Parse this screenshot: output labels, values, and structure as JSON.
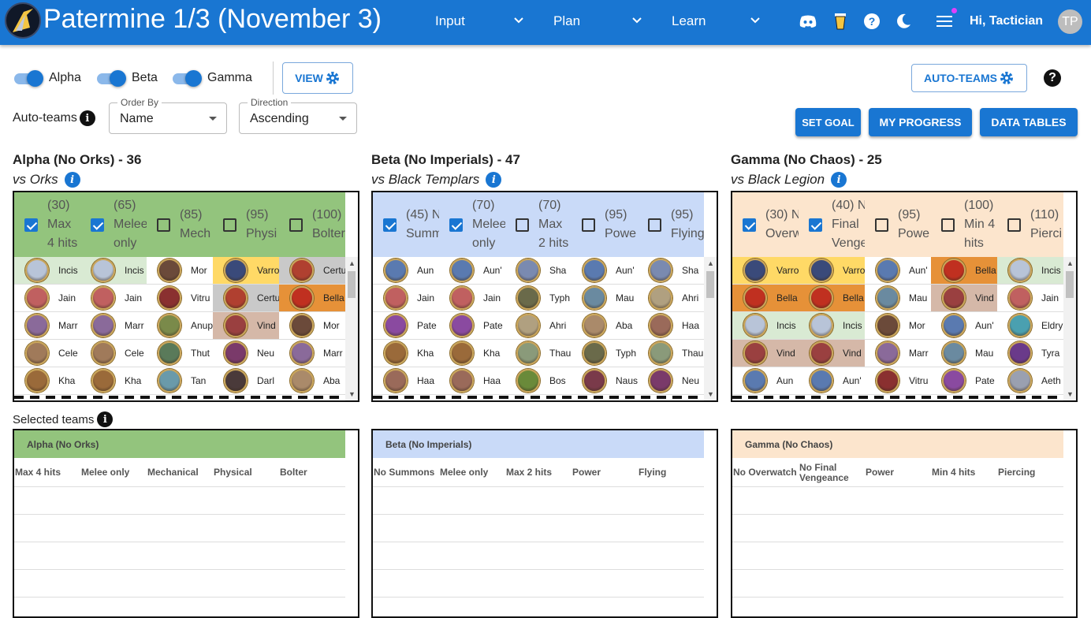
{
  "app": {
    "title": "Patermine 1/3 (November 3)",
    "greeting": "Hi, Tactician",
    "avatar_initials": "TP"
  },
  "nav": [
    {
      "label": "Input"
    },
    {
      "label": "Plan"
    },
    {
      "label": "Learn"
    }
  ],
  "top_icons": [
    "discord-icon",
    "coffee-cup-icon",
    "help-circle-icon",
    "dark-mode-moon-icon",
    "hamburger-menu-icon"
  ],
  "toggles": [
    {
      "label": "Alpha",
      "on": true
    },
    {
      "label": "Beta",
      "on": true
    },
    {
      "label": "Gamma",
      "on": true
    }
  ],
  "buttons": {
    "view": "VIEW",
    "auto_teams": "AUTO-TEAMS",
    "set_goal": "SET GOAL",
    "my_progress": "MY PROGRESS",
    "data_tables": "DATA TABLES",
    "help": "?"
  },
  "auto_teams_label": "Auto-teams",
  "order_by": {
    "label": "Order By",
    "value": "Name"
  },
  "direction": {
    "label": "Direction",
    "value": "Ascending"
  },
  "selected_teams_label": "Selected teams",
  "colors": {
    "primary": "#1976d2",
    "alpha": "#93c47d",
    "beta": "#c9daf8",
    "gamma": "#fce5cd",
    "alpha_light": "#d9ead3",
    "yellow": "#ffd966",
    "orange": "#e69138",
    "taupe": "#d5b8a8",
    "grey": "#c9c9c9"
  },
  "guilds": [
    {
      "title": "Alpha (No Orks) - 36",
      "subtitle": "vs Orks",
      "header_color": "#93c47d",
      "columns": [
        {
          "checked": true,
          "lines": [
            "(30)",
            "Max",
            "4 hits"
          ]
        },
        {
          "checked": true,
          "lines": [
            "(65)",
            "Melee",
            "only"
          ]
        },
        {
          "checked": false,
          "lines": [
            "(85)",
            "Mech"
          ]
        },
        {
          "checked": false,
          "lines": [
            "(95)",
            "Physi"
          ]
        },
        {
          "checked": false,
          "lines": [
            "(100)",
            "Bolter"
          ]
        }
      ],
      "rows": [
        [
          {
            "name": "Incis",
            "bg": "#d9ead3",
            "c": "#b8c4d8"
          },
          {
            "name": "Incis",
            "bg": "#d9ead3",
            "c": "#b8c4d8"
          },
          {
            "name": "Mor",
            "bg": "",
            "c": "#6b4a3a"
          },
          {
            "name": "Varro",
            "bg": "#ffd966",
            "c": "#3a4a7a"
          },
          {
            "name": "Certu",
            "bg": "#c9c9c9",
            "c": "#b04030"
          }
        ],
        [
          {
            "name": "Jain",
            "bg": "",
            "c": "#c06060"
          },
          {
            "name": "Jain",
            "bg": "",
            "c": "#c06060"
          },
          {
            "name": "Vitru",
            "bg": "",
            "c": "#8a3030"
          },
          {
            "name": "Certu",
            "bg": "#c9c9c9",
            "c": "#b04030"
          },
          {
            "name": "Bella",
            "bg": "#e69138",
            "c": "#c03020"
          }
        ],
        [
          {
            "name": "Marr",
            "bg": "",
            "c": "#8a6a9a"
          },
          {
            "name": "Marr",
            "bg": "",
            "c": "#8a6a9a"
          },
          {
            "name": "Anup",
            "bg": "",
            "c": "#7a8a4a"
          },
          {
            "name": "Vind",
            "bg": "#d5b8a8",
            "c": "#9a4040"
          },
          {
            "name": "Mor",
            "bg": "",
            "c": "#6b4a3a"
          }
        ],
        [
          {
            "name": "Cele",
            "bg": "",
            "c": "#a07a5a"
          },
          {
            "name": "Cele",
            "bg": "",
            "c": "#a07a5a"
          },
          {
            "name": "Thut",
            "bg": "",
            "c": "#5a7a5a"
          },
          {
            "name": "Neu",
            "bg": "",
            "c": "#7a3a6a"
          },
          {
            "name": "Marr",
            "bg": "",
            "c": "#8a6a9a"
          }
        ],
        [
          {
            "name": "Kha",
            "bg": "",
            "c": "#9a6a3a"
          },
          {
            "name": "Kha",
            "bg": "",
            "c": "#9a6a3a"
          },
          {
            "name": "Tan",
            "bg": "",
            "c": "#6a9aaa"
          },
          {
            "name": "Darl",
            "bg": "",
            "c": "#4a3a3a"
          },
          {
            "name": "Aba",
            "bg": "",
            "c": "#aa8a6a"
          }
        ]
      ],
      "team_header": "Alpha (No Orks)",
      "team_columns": [
        [
          "Max 4 hits"
        ],
        [
          "Melee only"
        ],
        [
          "Mechanical"
        ],
        [
          "Physical"
        ],
        [
          "Bolter"
        ]
      ]
    },
    {
      "title": "Beta (No Imperials) - 47",
      "subtitle": "vs Black Templars",
      "header_color": "#c9daf8",
      "columns": [
        {
          "checked": true,
          "lines": [
            "(45) N",
            "Summ"
          ]
        },
        {
          "checked": true,
          "lines": [
            "(70)",
            "Melee",
            "only"
          ]
        },
        {
          "checked": false,
          "lines": [
            "(70)",
            "Max",
            "2 hits"
          ]
        },
        {
          "checked": false,
          "lines": [
            "(95)",
            "Powe"
          ]
        },
        {
          "checked": false,
          "lines": [
            "(95)",
            "Flying"
          ]
        }
      ],
      "rows": [
        [
          {
            "name": "Aun",
            "bg": "",
            "c": "#5a7ab0"
          },
          {
            "name": "Aun'",
            "bg": "",
            "c": "#5a7ab0"
          },
          {
            "name": "Sha",
            "bg": "",
            "c": "#7a8ab0"
          },
          {
            "name": "Aun'",
            "bg": "",
            "c": "#5a7ab0"
          },
          {
            "name": "Sha",
            "bg": "",
            "c": "#7a8ab0"
          }
        ],
        [
          {
            "name": "Jain",
            "bg": "",
            "c": "#c06060"
          },
          {
            "name": "Jain",
            "bg": "",
            "c": "#c06060"
          },
          {
            "name": "Typh",
            "bg": "",
            "c": "#6a6a4a"
          },
          {
            "name": "Mau",
            "bg": "",
            "c": "#6a8aa0"
          },
          {
            "name": "Ahri",
            "bg": "",
            "c": "#b0a080"
          }
        ],
        [
          {
            "name": "Pate",
            "bg": "",
            "c": "#8a4aa0"
          },
          {
            "name": "Pate",
            "bg": "",
            "c": "#8a4aa0"
          },
          {
            "name": "Ahri",
            "bg": "",
            "c": "#b0a080"
          },
          {
            "name": "Aba",
            "bg": "",
            "c": "#aa8a6a"
          },
          {
            "name": "Haa",
            "bg": "",
            "c": "#9a6a5a"
          }
        ],
        [
          {
            "name": "Kha",
            "bg": "",
            "c": "#9a6a3a"
          },
          {
            "name": "Kha",
            "bg": "",
            "c": "#9a6a3a"
          },
          {
            "name": "Thau",
            "bg": "",
            "c": "#8a9a7a"
          },
          {
            "name": "Typh",
            "bg": "",
            "c": "#6a6a4a"
          },
          {
            "name": "Thau",
            "bg": "",
            "c": "#8a9a7a"
          }
        ],
        [
          {
            "name": "Haa",
            "bg": "",
            "c": "#9a6a5a"
          },
          {
            "name": "Haa",
            "bg": "",
            "c": "#9a6a5a"
          },
          {
            "name": "Bos",
            "bg": "",
            "c": "#6a8a3a"
          },
          {
            "name": "Naus",
            "bg": "",
            "c": "#7a3a4a"
          },
          {
            "name": "Neu",
            "bg": "",
            "c": "#7a3a6a"
          }
        ]
      ],
      "team_header": "Beta (No Imperials)",
      "team_columns": [
        [
          "No Summons"
        ],
        [
          "Melee only"
        ],
        [
          "Max 2 hits"
        ],
        [
          "Power"
        ],
        [
          "Flying"
        ]
      ]
    },
    {
      "title": "Gamma (No Chaos) - 25",
      "subtitle": "vs Black Legion",
      "header_color": "#fce5cd",
      "columns": [
        {
          "checked": true,
          "lines": [
            "(30) N",
            "Overw"
          ]
        },
        {
          "checked": true,
          "lines": [
            "(40) N",
            "Final",
            "Venge"
          ]
        },
        {
          "checked": false,
          "lines": [
            "(95)",
            "Powe"
          ]
        },
        {
          "checked": false,
          "lines": [
            "(100)",
            "Min 4",
            "hits"
          ]
        },
        {
          "checked": false,
          "lines": [
            "(110)",
            "Pierci"
          ]
        }
      ],
      "rows": [
        [
          {
            "name": "Varro",
            "bg": "#ffd966",
            "c": "#3a4a7a"
          },
          {
            "name": "Varro",
            "bg": "#ffd966",
            "c": "#3a4a7a"
          },
          {
            "name": "Aun'",
            "bg": "",
            "c": "#5a7ab0"
          },
          {
            "name": "Bella",
            "bg": "#e69138",
            "c": "#c03020"
          },
          {
            "name": "Incis",
            "bg": "#d9ead3",
            "c": "#b8c4d8"
          }
        ],
        [
          {
            "name": "Bella",
            "bg": "#e69138",
            "c": "#c03020"
          },
          {
            "name": "Bella",
            "bg": "#e69138",
            "c": "#c03020"
          },
          {
            "name": "Mau",
            "bg": "",
            "c": "#6a8aa0"
          },
          {
            "name": "Vind",
            "bg": "#d5b8a8",
            "c": "#9a4040"
          },
          {
            "name": "Jain",
            "bg": "",
            "c": "#c06060"
          }
        ],
        [
          {
            "name": "Incis",
            "bg": "#d9ead3",
            "c": "#b8c4d8"
          },
          {
            "name": "Incis",
            "bg": "#d9ead3",
            "c": "#b8c4d8"
          },
          {
            "name": "Mor",
            "bg": "",
            "c": "#6b4a3a"
          },
          {
            "name": "Aun'",
            "bg": "",
            "c": "#5a7ab0"
          },
          {
            "name": "Eldry",
            "bg": "",
            "c": "#4aa0b0"
          }
        ],
        [
          {
            "name": "Vind",
            "bg": "#d5b8a8",
            "c": "#9a4040"
          },
          {
            "name": "Vind",
            "bg": "#d5b8a8",
            "c": "#9a4040"
          },
          {
            "name": "Marr",
            "bg": "",
            "c": "#8a6a9a"
          },
          {
            "name": "Mau",
            "bg": "",
            "c": "#6a8aa0"
          },
          {
            "name": "Tyra",
            "bg": "",
            "c": "#6a3a8a"
          }
        ],
        [
          {
            "name": "Aun",
            "bg": "",
            "c": "#5a7ab0"
          },
          {
            "name": "Aun'",
            "bg": "",
            "c": "#5a7ab0"
          },
          {
            "name": "Vitru",
            "bg": "",
            "c": "#8a3030"
          },
          {
            "name": "Pate",
            "bg": "",
            "c": "#8a4aa0"
          },
          {
            "name": "Aeth",
            "bg": "",
            "c": "#9aa0b0"
          }
        ]
      ],
      "team_header": "Gamma (No Chaos)",
      "team_columns": [
        [
          "No Overwatch"
        ],
        [
          "No Final",
          "Vengeance"
        ],
        [
          "Power"
        ],
        [
          "Min 4 hits"
        ],
        [
          "Piercing"
        ]
      ]
    }
  ]
}
